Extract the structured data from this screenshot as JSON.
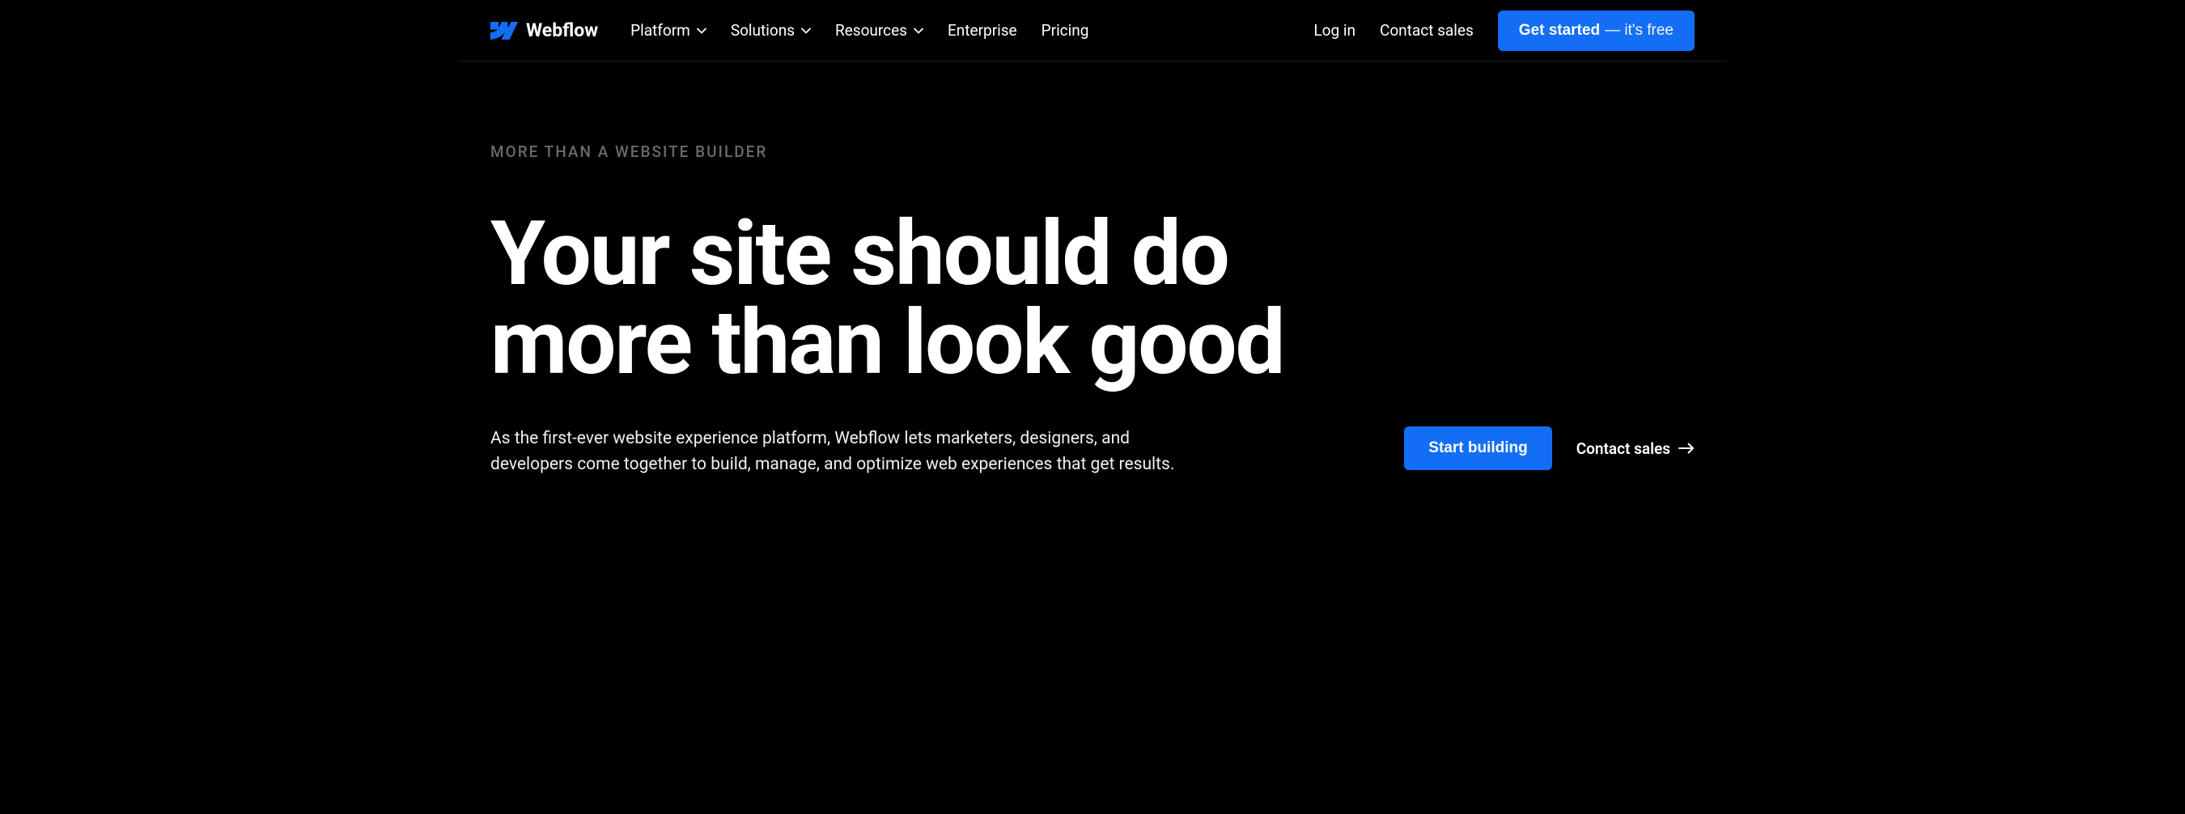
{
  "brand": {
    "name": "Webflow"
  },
  "nav": {
    "items": [
      {
        "label": "Platform",
        "hasDropdown": true
      },
      {
        "label": "Solutions",
        "hasDropdown": true
      },
      {
        "label": "Resources",
        "hasDropdown": true
      },
      {
        "label": "Enterprise",
        "hasDropdown": false
      },
      {
        "label": "Pricing",
        "hasDropdown": false
      }
    ],
    "login": "Log in",
    "contact": "Contact sales",
    "cta_primary": "Get started",
    "cta_secondary": "— it's free"
  },
  "hero": {
    "eyebrow": "MORE THAN A WEBSITE BUILDER",
    "headline": "Your site should do more than look good",
    "subhead": "As the first-ever website experience platform, Webflow lets marketers, designers, and developers come together to build, manage, and optimize web experiences that get results.",
    "primary_cta": "Start building",
    "secondary_cta": "Contact sales"
  },
  "colors": {
    "accent": "#146EF5",
    "background": "#000000",
    "text": "#ffffff",
    "muted": "#6a6a6a"
  }
}
